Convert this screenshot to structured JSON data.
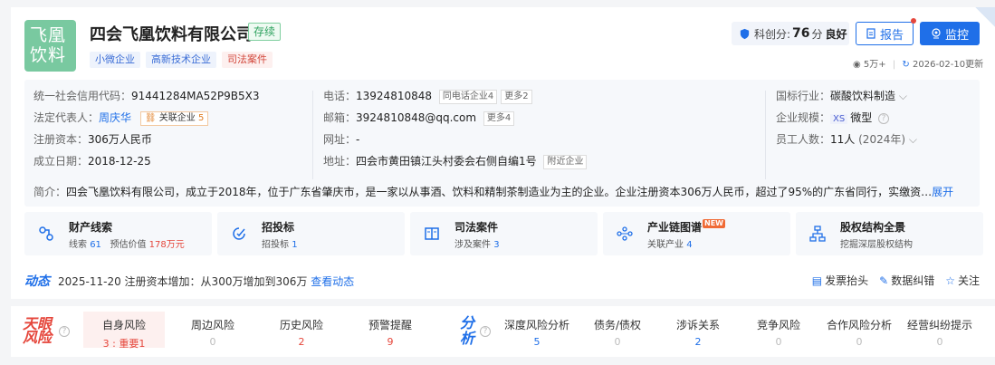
{
  "company": {
    "logo_line1": "飞凰",
    "logo_line2": "饮料",
    "name": "四会飞凰饮料有限公司",
    "status": "存续",
    "tags": [
      "小微企业",
      "高新技术企业",
      "司法案件"
    ]
  },
  "header_right": {
    "score_label": "科创分:",
    "score_value": "76",
    "score_unit": "分",
    "score_grade": "良好",
    "report_label": "报告",
    "monitor_label": "监控",
    "views": "5万+",
    "updated": "2026-02-10更新"
  },
  "info": {
    "credit_code_label": "统一社会信用代码：",
    "credit_code": "91441284MA52P9B5X3",
    "legal_rep_label": "法定代表人：",
    "legal_rep": "周庆华",
    "related_companies_label": "关联企业",
    "related_companies_count": "5",
    "capital_label": "注册资本：",
    "capital": "306万人民币",
    "founded_label": "成立日期：",
    "founded": "2018-12-25",
    "phone_label": "电话：",
    "phone": "13924810848",
    "phone_same": "同电话企业4",
    "phone_more": "更多2",
    "email_label": "邮箱：",
    "email": "3924810848@qq.com",
    "email_more": "更多4",
    "website_label": "网址：",
    "website": "-",
    "address_label": "地址：",
    "address": "四会市黄田镇江头村委会右侧自编1号",
    "address_nearby": "附近企业",
    "industry_label": "国标行业：",
    "industry": "碳酸饮料制造",
    "scale_label": "企业规模：",
    "scale_badge": "XS",
    "scale": "微型",
    "staff_label": "员工人数：",
    "staff": "11人",
    "staff_year": "(2024年)",
    "intro_label": "简介：",
    "intro": "四会飞凰饮料有限公司，成立于2018年，位于广东省肇庆市，是一家以从事酒、饮料和精制茶制造业为主的企业。企业注册资本306万人民币，超过了95%的广东省同行，实缴资…",
    "intro_expand": "展开"
  },
  "features": [
    {
      "title": "财产线索",
      "sub1": "线索",
      "n1": "61",
      "sub2": "预估价值",
      "n2": "178万元"
    },
    {
      "title": "招投标",
      "sub1": "招投标",
      "n1": "1"
    },
    {
      "title": "司法案件",
      "sub1": "涉及案件",
      "n1": "3"
    },
    {
      "title": "产业链图谱",
      "badge": "NEW",
      "sub1": "关联产业",
      "n1": "4"
    },
    {
      "title": "股权结构全景",
      "sub1": "挖掘深层股权结构"
    }
  ],
  "dynamic": {
    "logo": "动态",
    "text": "2025-11-20 注册资本增加：从300万增加到306万",
    "link": "查看动态",
    "actions": [
      "发票抬头",
      "数据纠错",
      "关注"
    ]
  },
  "risk": {
    "logo_line1": "天眼",
    "logo_line2": "风险",
    "items": [
      {
        "title": "自身风险",
        "value": "3 : 重要1"
      },
      {
        "title": "周边风险",
        "value": "0"
      },
      {
        "title": "历史风险",
        "value": "2"
      },
      {
        "title": "预警提醒",
        "value": "9"
      }
    ],
    "analysis_logo_line1": "分",
    "analysis_logo_line2": "析",
    "analysis": [
      {
        "title": "深度风险分析",
        "value": "5"
      },
      {
        "title": "债务/债权",
        "value": "0"
      },
      {
        "title": "涉诉关系",
        "value": "2"
      },
      {
        "title": "竞争风险",
        "value": "0"
      },
      {
        "title": "合作风险分析",
        "value": "0"
      },
      {
        "title": "经营纠纷提示",
        "value": "0"
      }
    ]
  },
  "colors": {
    "brand": "#1f6fe8",
    "risk": "#e5463b",
    "logo_bg": "#79c9a0"
  }
}
